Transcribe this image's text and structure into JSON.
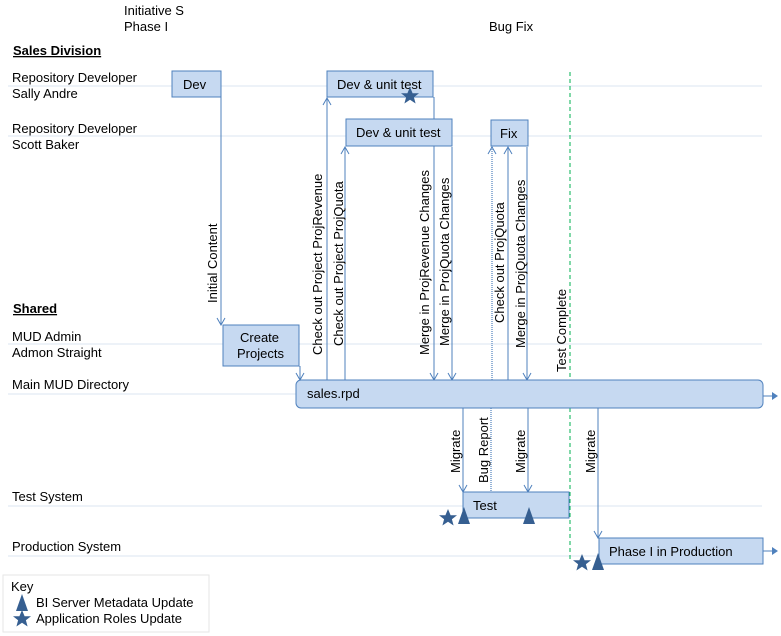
{
  "header": {
    "initiative_line1": "Initiative S",
    "initiative_line2": "Phase I",
    "bugfix": "Bug Fix"
  },
  "sections": {
    "sales": "Sales Division",
    "shared": "Shared"
  },
  "lanes": [
    {
      "role": "Repository Developer",
      "name": "Sally Andre"
    },
    {
      "role": "Repository Developer",
      "name": "Scott Baker"
    },
    {
      "role": "MUD Admin",
      "name": "Admon Straight"
    },
    {
      "role": "Main MUD Directory",
      "name": ""
    },
    {
      "role": "Test System",
      "name": ""
    },
    {
      "role": "Production System",
      "name": ""
    }
  ],
  "boxes": {
    "dev": "Dev",
    "dev_unit_test_sally": "Dev & unit test",
    "dev_unit_test_scott": "Dev & unit test",
    "fix": "Fix",
    "create_projects_1": "Create",
    "create_projects_2": "Projects",
    "sales_rpd": "sales.rpd",
    "test": "Test",
    "phase_production": "Phase I in Production"
  },
  "flows": {
    "initial_content": "Initial Content",
    "checkout_revenue": "Check out Project ProjRevenue",
    "checkout_quota": "Check out Project ProjQuota",
    "merge_revenue": "Merge in ProjRevenue  Changes",
    "merge_quota": "Merge in ProjQuota Changes",
    "checkout_quota_fix": "Check out ProjQuota",
    "merge_quota_fix": "Merge in ProjQuota Changes",
    "test_complete": "Test Complete",
    "migrate_1": "Migrate",
    "bug_report": "Bug Report",
    "migrate_2": "Migrate",
    "migrate_3": "Migrate"
  },
  "key": {
    "title": "Key",
    "items": [
      {
        "icon": "triangle-icon",
        "label": "BI Server Metadata Update"
      },
      {
        "icon": "star-icon",
        "label": "Application Roles Update"
      }
    ]
  },
  "colors": {
    "box_fill": "#c6d9f1",
    "box_stroke": "#4f81bd",
    "milestone": "#00b050",
    "marker": "#365f91"
  }
}
